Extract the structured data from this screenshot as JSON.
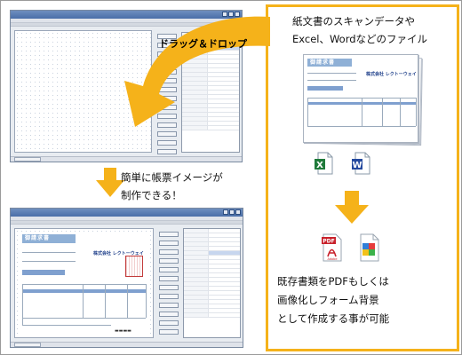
{
  "accent_color": "#f5b21a",
  "drag_drop_label": "ドラッグ＆ドロップ",
  "caption_top": [
    "紙文書のスキャンデータや",
    "Excel、Wordなどのファイル"
  ],
  "caption_middle": [
    "簡単に帳票イメージが",
    "制作できる！"
  ],
  "caption_bottom": [
    "既存書類をPDFもしくは",
    "画像化しフォーム背景",
    "として作成する事が可能"
  ],
  "form_document": {
    "title": "御請求書",
    "company_logo_text": "株式会社 レクトーウェイ"
  },
  "icons": {
    "excel": {
      "name": "excel-file-icon",
      "letter": "X"
    },
    "word": {
      "name": "word-file-icon",
      "letter": "W"
    },
    "pdf": {
      "name": "pdf-file-icon",
      "label": "PDF",
      "sublabel": "Adobe"
    },
    "image": {
      "name": "image-file-icon"
    }
  }
}
